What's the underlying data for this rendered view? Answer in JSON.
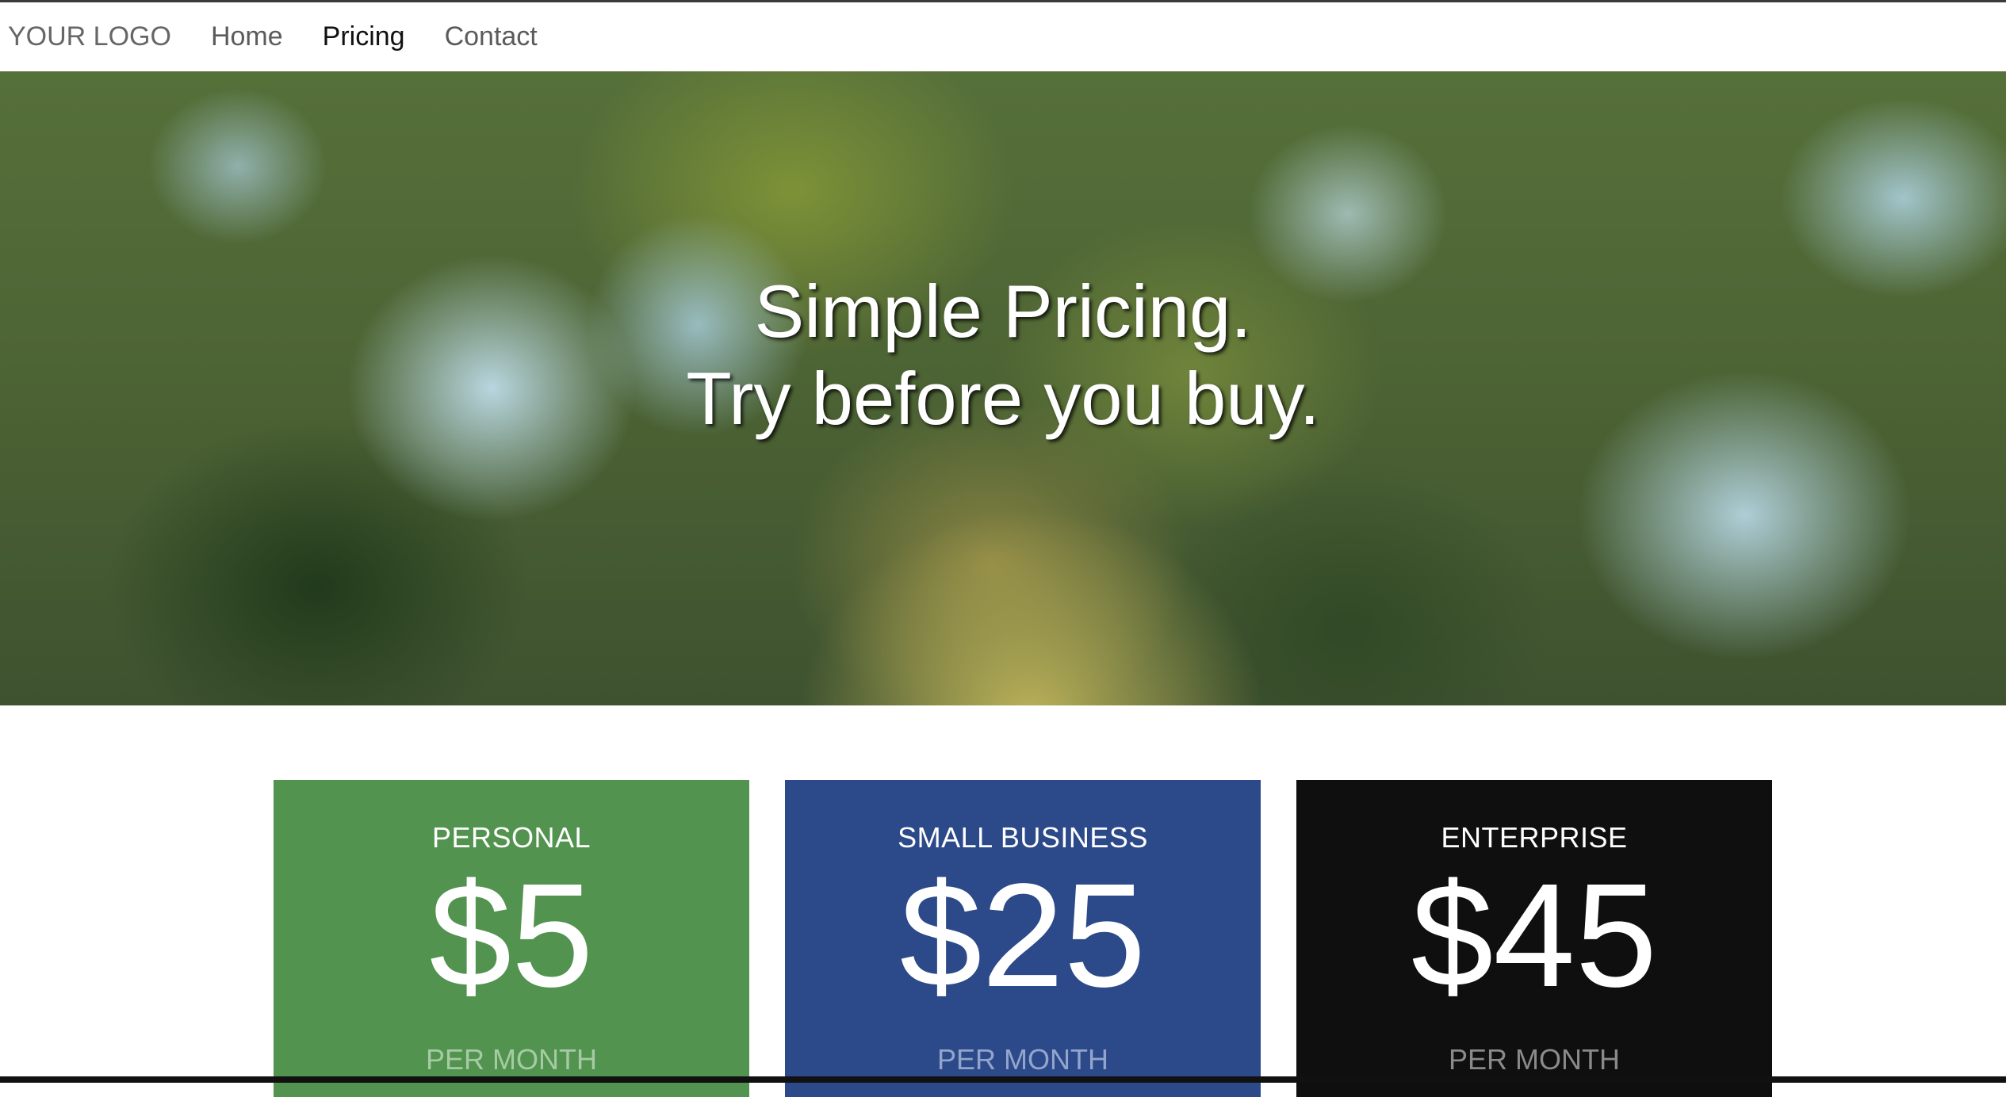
{
  "nav": {
    "logo": "YOUR LOGO",
    "items": [
      {
        "label": "Home",
        "active": false
      },
      {
        "label": "Pricing",
        "active": true
      },
      {
        "label": "Contact",
        "active": false
      }
    ]
  },
  "hero": {
    "line1": "Simple Pricing.",
    "line2": "Try before you buy."
  },
  "plans": [
    {
      "name": "PERSONAL",
      "price": "$5",
      "period": "PER MONTH",
      "color": "#52934f"
    },
    {
      "name": "SMALL BUSINESS",
      "price": "$25",
      "period": "PER MONTH",
      "color": "#2c4989"
    },
    {
      "name": "ENTERPRISE",
      "price": "$45",
      "period": "PER MONTH",
      "color": "#0f0f0f"
    }
  ]
}
